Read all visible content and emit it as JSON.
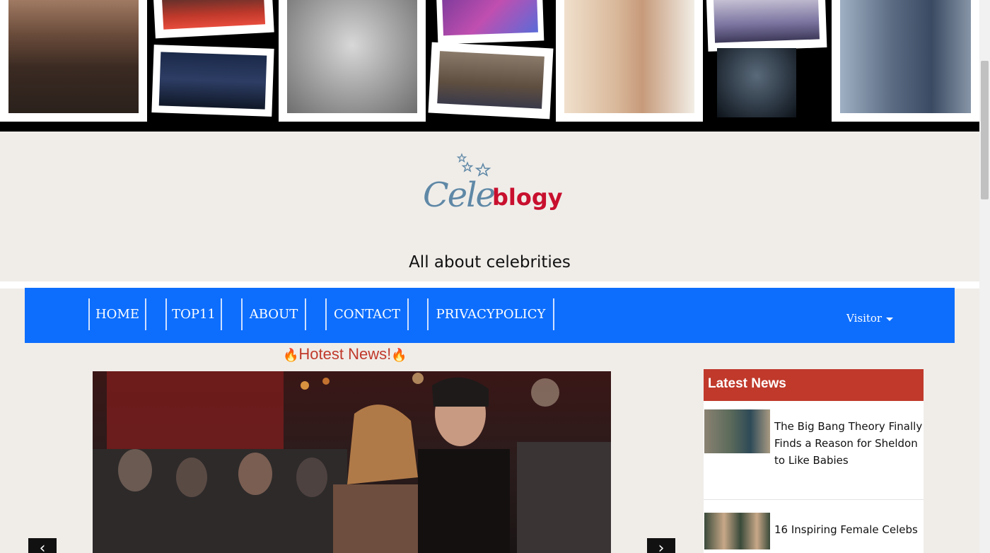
{
  "header": {
    "logo_cele": "Cele",
    "logo_blogy": "blogy",
    "tagline": "All about celebrities"
  },
  "nav": {
    "items": [
      {
        "label": "HOME"
      },
      {
        "label": "TOP11"
      },
      {
        "label": "ABOUT"
      },
      {
        "label": "CONTACT"
      },
      {
        "label": "PRIVACYPOLICY"
      }
    ],
    "visitor_label": "Visitor"
  },
  "main": {
    "hot_title": "Hotest News!",
    "prev_label": "‹",
    "next_label": "›"
  },
  "sidebar": {
    "title": "Latest News",
    "items": [
      {
        "title": "The Big Bang Theory Finally Finds a Reason for Sheldon to Like Babies"
      },
      {
        "title": "16 Inspiring Female Celebs"
      }
    ]
  },
  "colors": {
    "nav_bg": "#0d6efd",
    "sidebar_head": "#c0392b",
    "hot_title": "#c0392b",
    "logo_blue": "#5f88a6",
    "logo_red": "#c8102e",
    "page_bg": "#f0ede9"
  }
}
